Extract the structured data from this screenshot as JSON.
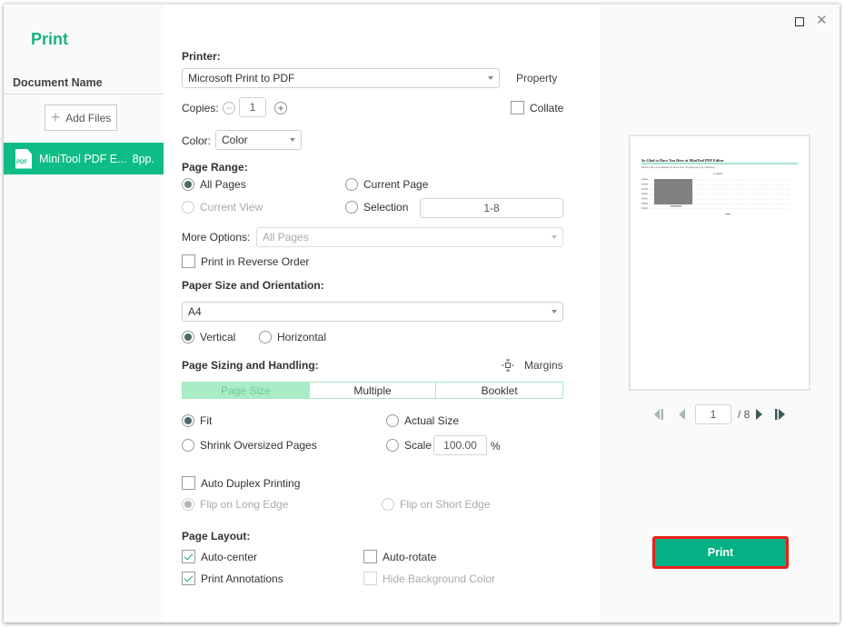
{
  "app": {
    "title": "Print"
  },
  "window_controls": {
    "maximize": "maximize-icon",
    "close": "close-icon"
  },
  "sidebar": {
    "header": "Document Name",
    "add_files_label": "Add Files",
    "files": [
      {
        "name": "MiniTool PDF E...",
        "pages": "8pp.",
        "icon": "pdf-file-icon",
        "icon_label": "PDF",
        "selected": true
      }
    ]
  },
  "printer": {
    "title": "Printer:",
    "selected": "Microsoft Print to PDF",
    "property_label": "Property",
    "copies_label": "Copies:",
    "copies_value": "1",
    "collate_label": "Collate",
    "collate_checked": false,
    "color_label": "Color:",
    "color_value": "Color"
  },
  "page_range": {
    "title": "Page Range:",
    "all_pages": "All Pages",
    "current_page": "Current Page",
    "current_view": "Current View",
    "selection": "Selection",
    "selection_value": "1-8",
    "selected_option": "All Pages",
    "more_options_label": "More Options:",
    "more_options_value": "All Pages",
    "reverse_order_label": "Print in Reverse Order",
    "reverse_order_checked": false
  },
  "paper": {
    "title": "Paper Size and Orientation:",
    "size": "A4",
    "vertical": "Vertical",
    "horizontal": "Horizontal",
    "orientation": "Vertical"
  },
  "sizing": {
    "title": "Page Sizing and Handling:",
    "margins_label": "Margins",
    "tabs": [
      {
        "label": "Page Size",
        "active": true
      },
      {
        "label": "Multiple",
        "active": false
      },
      {
        "label": "Booklet",
        "active": false
      }
    ],
    "fit": "Fit",
    "actual_size": "Actual Size",
    "shrink": "Shrink Oversized Pages",
    "scale": "Scale",
    "scale_value": "100.00",
    "scale_unit": "%",
    "selected_option": "Fit"
  },
  "duplex": {
    "auto_duplex_label": "Auto Duplex Printing",
    "auto_duplex_checked": false,
    "long_edge": "Flip on Long Edge",
    "short_edge": "Flip on Short Edge"
  },
  "layout": {
    "title": "Page Layout:",
    "auto_center": "Auto-center",
    "auto_center_checked": true,
    "auto_rotate": "Auto-rotate",
    "auto_rotate_checked": false,
    "print_annotations": "Print Annotations",
    "print_annotations_checked": true,
    "hide_background": "Hide Background Color",
    "hide_background_checked": false
  },
  "preview": {
    "current_page": "1",
    "total_pages": "/ 8",
    "thumbnail_heading": "So Glad to Have You Here at MiniTool PDF Editor",
    "thumbnail_subheading": "Please take a few minutes to know how we improve your efficiency",
    "thumbnail_toc_title": "Content",
    "accent_color": "#0ebd85"
  },
  "print_button_label": "Print"
}
